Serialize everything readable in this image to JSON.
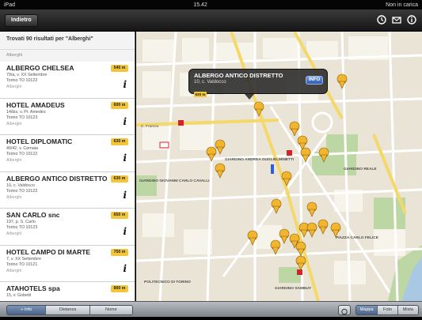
{
  "status_bar": {
    "device": "iPad",
    "time": "15.42",
    "battery": "Non in carica"
  },
  "nav": {
    "back_label": "Indietro",
    "icons": [
      "clock-icon",
      "mail-icon",
      "info-icon"
    ]
  },
  "sidebar": {
    "header": "Trovati 90 risultati per \"Alberghi\"",
    "section_label": "Alberghi",
    "results": [
      {
        "name": "ALBERGO CHELSEA",
        "addr1": "79/a, v. XX Settembre",
        "addr2": "Torino TO 10122",
        "category": "Alberghi",
        "distance": "540 m"
      },
      {
        "name": "HOTEL AMADEUS",
        "addr1": "14/bis, v. Pr. Amedeo",
        "addr2": "Torino TO 10123",
        "category": "Alberghi",
        "distance": "600 m"
      },
      {
        "name": "HOTEL DIPLOMATIC",
        "addr1": "40/42, v. Cernaia",
        "addr2": "Torino TO 10122",
        "category": "Alberghi",
        "distance": "630 m"
      },
      {
        "name": "ALBERGO ANTICO DISTRETTO",
        "addr1": "10, c. Valdocco",
        "addr2": "Torino TO 10122",
        "category": "Alberghi",
        "distance": "630 m"
      },
      {
        "name": "SAN CARLO snc",
        "addr1": "197, p. S. Carlo",
        "addr2": "Torino TO 10123",
        "category": "Alberghi",
        "distance": "650 m"
      },
      {
        "name": "HOTEL CAMPO DI MARTE",
        "addr1": "7, v. XX Settembre",
        "addr2": "Torino TO 10121",
        "category": "Alberghi",
        "distance": "750 m"
      },
      {
        "name": "ATAHOTELS spa",
        "addr1": "15, v. Gobetti",
        "addr2": "",
        "category": "",
        "distance": "800 m"
      }
    ]
  },
  "callout": {
    "title": "ALBERGO ANTICO DISTRETTO",
    "address": "10, c. Valdocco",
    "distance": "630 m",
    "button": "INFO"
  },
  "map": {
    "labels": [
      "GIARDINO ANDREA GUGLIELMINETTI",
      "GIARDINO GIOVANNI CARLO CAVALLI",
      "GIARDINO REALE",
      "PIAZZA CARLO FELICE",
      "POLITECNICO DI TORINO",
      "GIARDINO SAMBUY",
      "C. Francia"
    ]
  },
  "bottom": {
    "left_tabs": [
      {
        "label": "+ Info",
        "active": true
      },
      {
        "label": "Distanza",
        "active": false
      },
      {
        "label": "Nome",
        "active": false
      }
    ],
    "right_tabs": [
      {
        "label": "Mappa",
        "active": true
      },
      {
        "label": "Foto",
        "active": false
      },
      {
        "label": "Mista",
        "active": false
      }
    ]
  },
  "colors": {
    "accent": "#f3c53b",
    "pin": "#f2b52e",
    "info_button": "#3a6bc4",
    "active_segment": "#5a76a0"
  }
}
